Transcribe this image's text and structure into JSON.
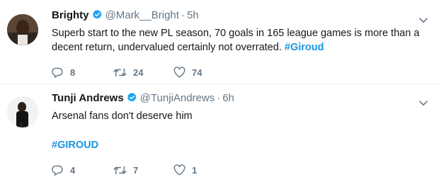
{
  "tweets": [
    {
      "name": "Brighty",
      "handle": "@Mark__Bright",
      "separator": "·",
      "time": "5h",
      "text": "Superb start to the new PL season, 70 goals in 165 league games is more than a",
      "text_line2_prefix": "decent return, undervalued certainly not overrated.",
      "hashtag": "#Giroud",
      "replies": "8",
      "retweets": "24",
      "likes": "74"
    },
    {
      "name": "Tunji Andrews",
      "handle": "@TunjiAndrews",
      "separator": "·",
      "time": "6h",
      "text": "Arsenal fans don't deserve him",
      "hashtag": "#GIROUD",
      "replies": "4",
      "retweets": "7",
      "likes": "1"
    }
  ],
  "colors": {
    "accent": "#1b95e0",
    "muted": "#657786",
    "text": "#14171a",
    "verified": "#1da1f2"
  },
  "icons": [
    "verified-badge-icon",
    "chevron-down-icon",
    "reply-icon",
    "retweet-icon",
    "like-icon"
  ]
}
